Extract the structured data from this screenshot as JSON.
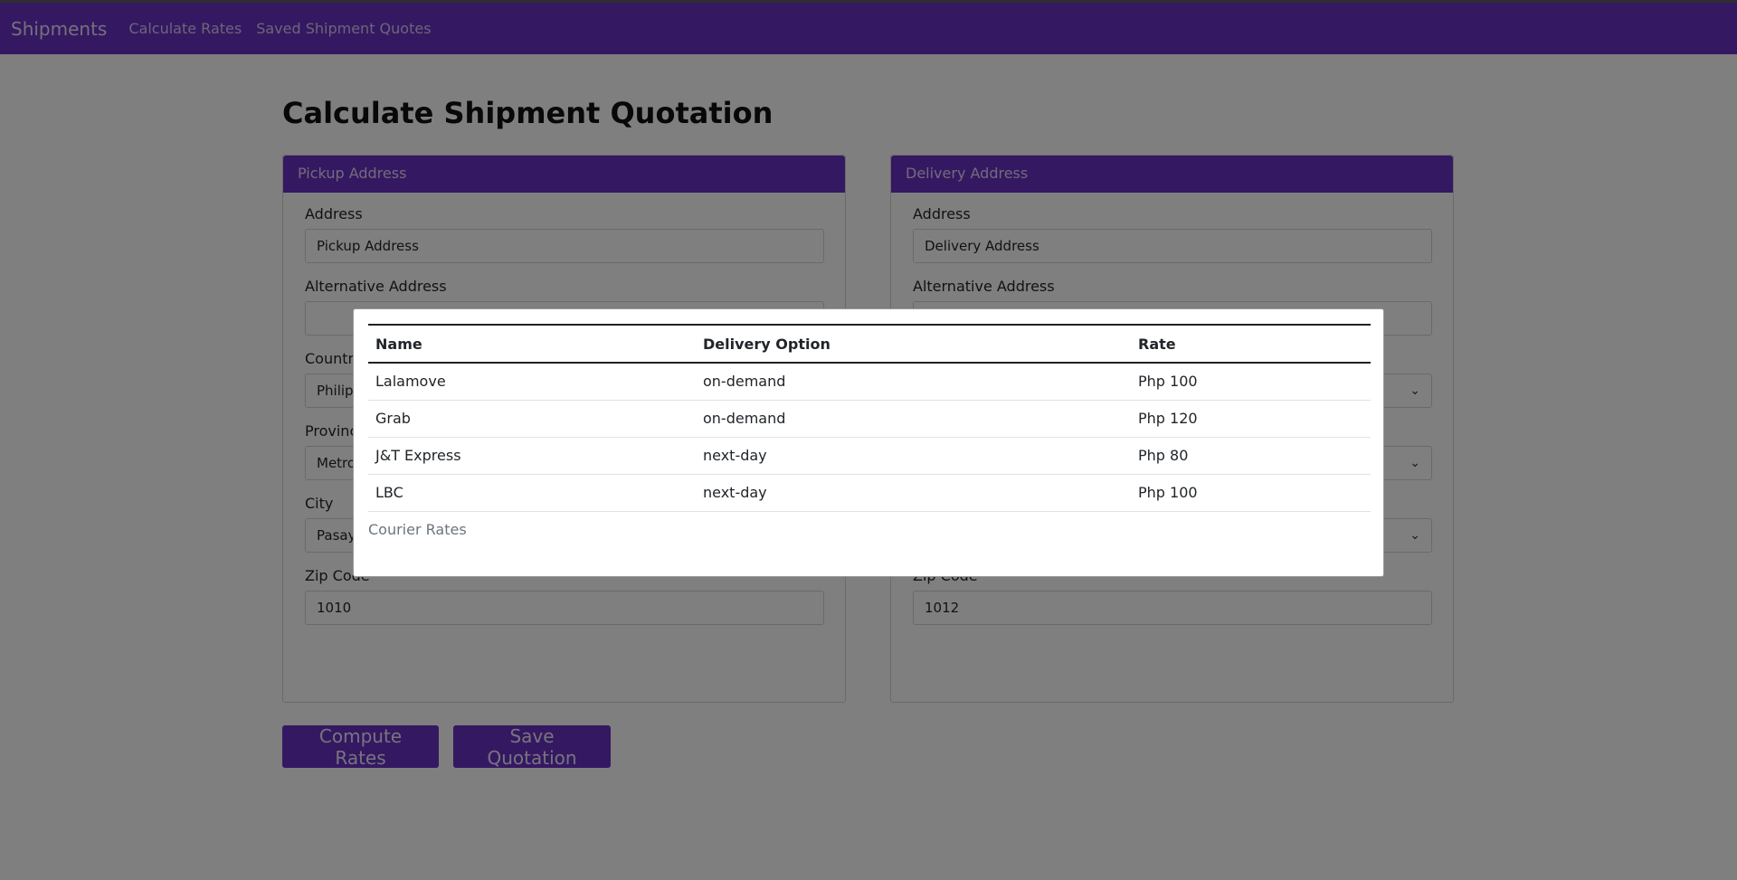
{
  "nav": {
    "brand": "Shipments",
    "links": [
      "Calculate Rates",
      "Saved Shipment Quotes"
    ]
  },
  "page": {
    "title": "Calculate Shipment Quotation"
  },
  "pickup": {
    "header": "Pickup Address",
    "address_label": "Address",
    "address_value": "Pickup Address",
    "alt_label": "Alternative Address",
    "alt_value": "",
    "country_label": "Country",
    "country_value": "Philippines",
    "province_label": "Province",
    "province_value": "Metro Manila",
    "city_label": "City",
    "city_value": "Pasay",
    "zip_label": "Zip Code",
    "zip_value": "1010"
  },
  "delivery": {
    "header": "Delivery Address",
    "address_label": "Address",
    "address_value": "Delivery Address",
    "alt_label": "Alternative Address",
    "alt_value": "",
    "zip_label": "Zip Code",
    "zip_value": "1012"
  },
  "buttons": {
    "compute": "Compute Rates",
    "save": "Save Quotation"
  },
  "modal": {
    "headers": [
      "Name",
      "Delivery Option",
      "Rate"
    ],
    "rows": [
      {
        "name": "Lalamove",
        "option": "on-demand",
        "rate": "Php 100"
      },
      {
        "name": "Grab",
        "option": "on-demand",
        "rate": "Php 120"
      },
      {
        "name": "J&T Express",
        "option": "next-day",
        "rate": "Php 80"
      },
      {
        "name": "LBC",
        "option": "next-day",
        "rate": "Php 100"
      }
    ],
    "caption": "Courier Rates"
  },
  "colors": {
    "primary": "#6a30c4",
    "overlay": "rgba(0,0,0,0.5)"
  }
}
